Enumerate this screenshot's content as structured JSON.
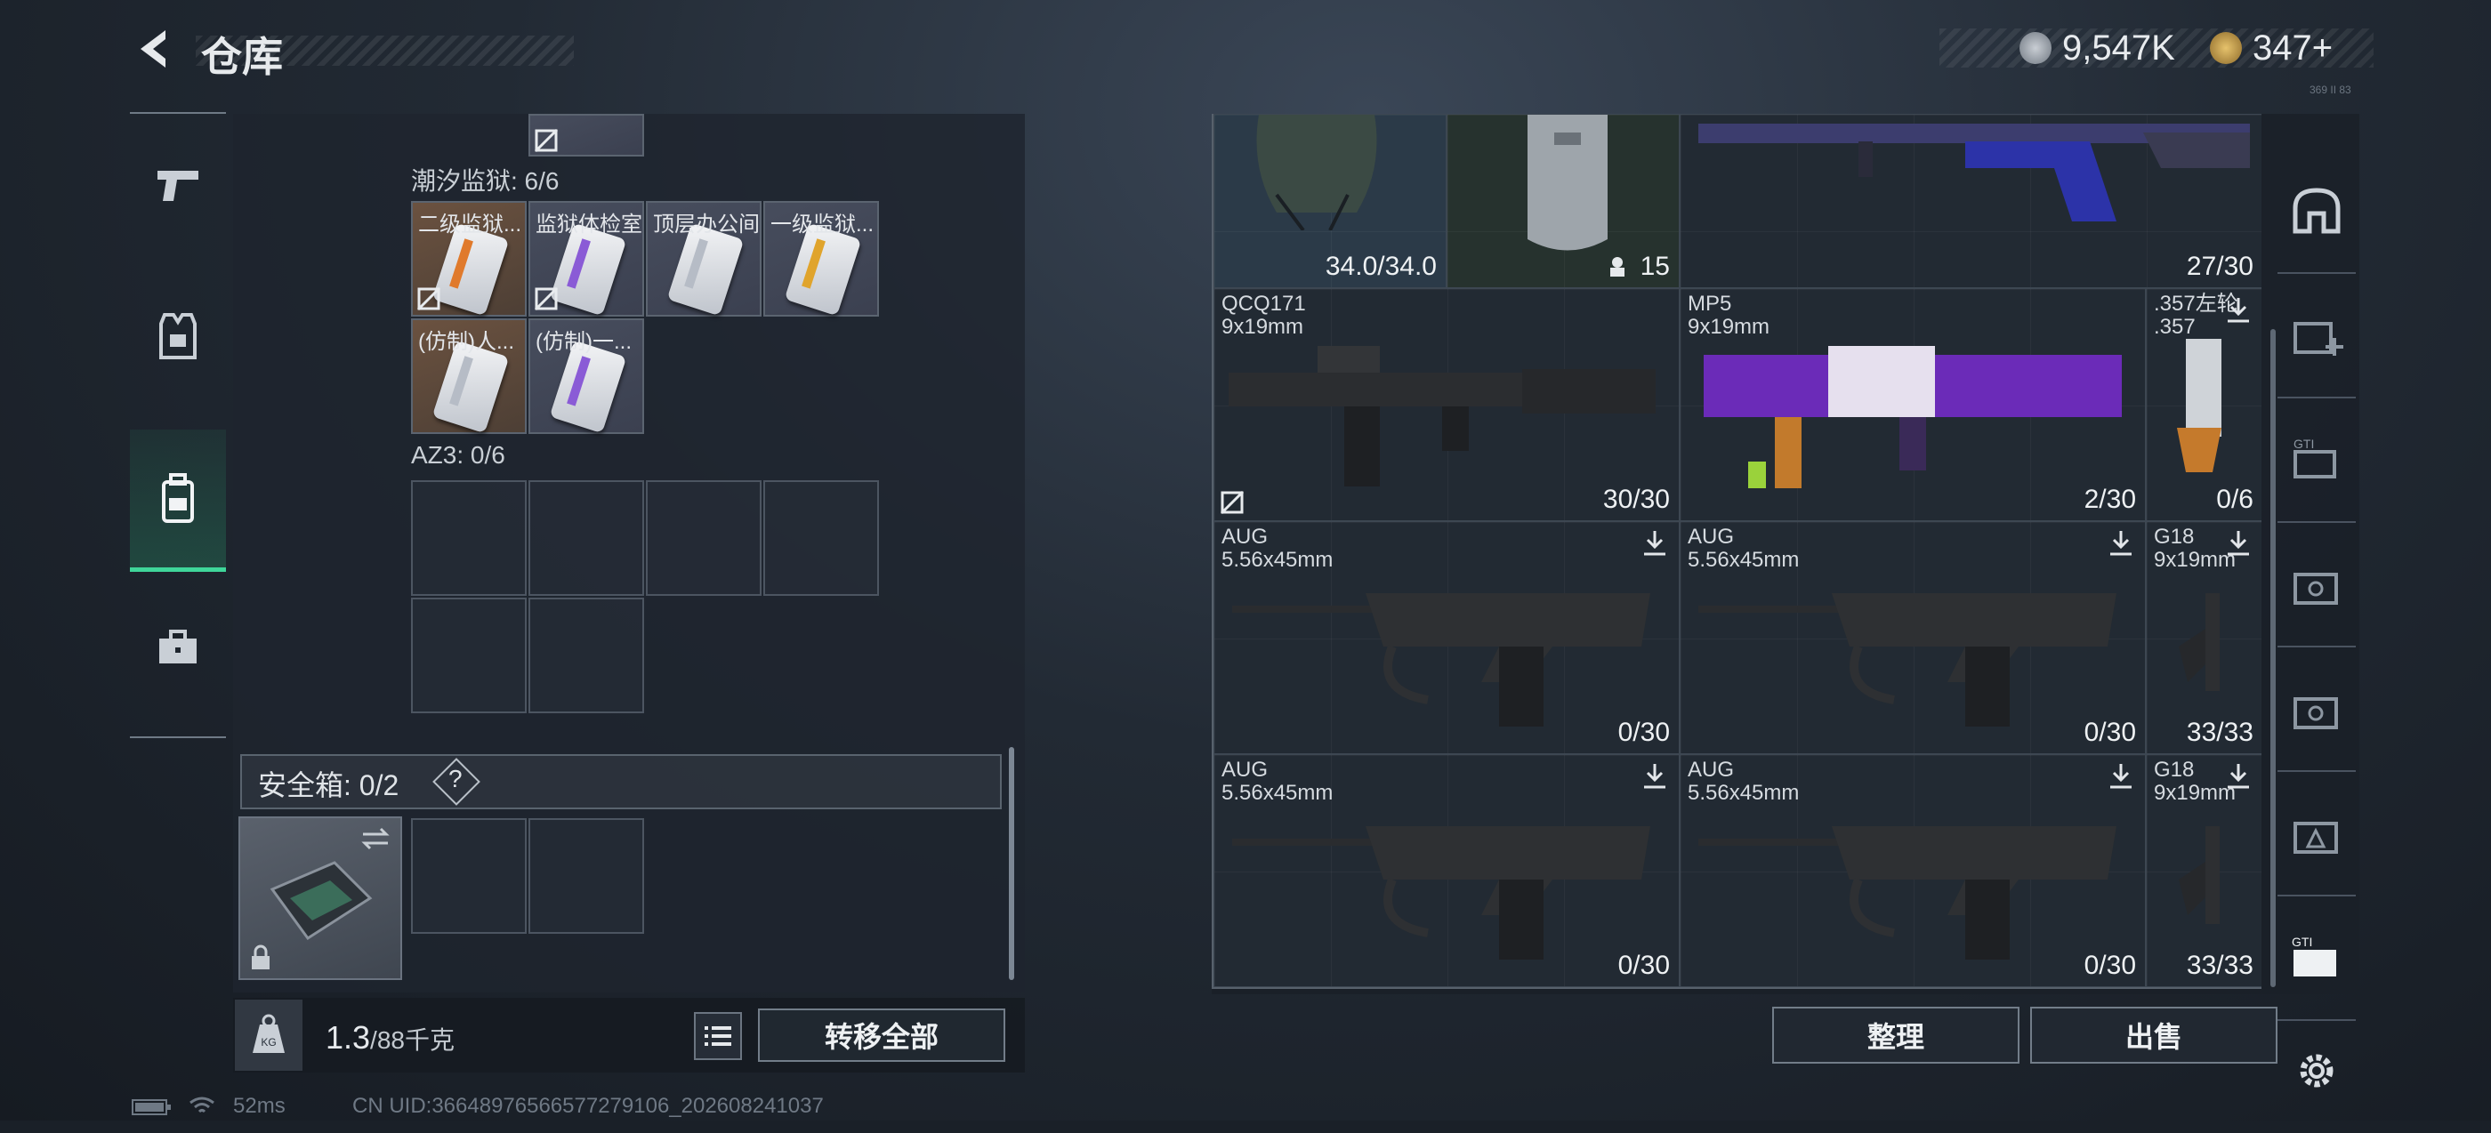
{
  "header": {
    "title": "仓库",
    "currency_1": "9,547K",
    "currency_2": "347+",
    "tiny_code": "369 II 83"
  },
  "left_nav": [
    "pistol-icon",
    "vest-icon",
    "backpack-icon",
    "toolbox-icon"
  ],
  "stash": {
    "section_a_label": "潮汐监狱: 6/6",
    "section_a_items": [
      {
        "name": "二级监狱...",
        "card": "orange-stripe",
        "no_loss": true
      },
      {
        "name": "监狱体检室",
        "card": "purple-stripe",
        "no_loss": true
      },
      {
        "name": "顶层办公间",
        "card": "plain",
        "no_loss": false
      },
      {
        "name": "一级监狱...",
        "card": "orange-stripe",
        "no_loss": false
      },
      {
        "name": "(仿制)人...",
        "card": "plain",
        "no_loss": false
      },
      {
        "name": "(仿制)一...",
        "card": "purple-stripe",
        "no_loss": false
      }
    ],
    "section_b_label": "AZ3: 0/6"
  },
  "safe_box": {
    "label": "安全箱: 0/2",
    "help": "?"
  },
  "bottom": {
    "weight_value": "1.3",
    "weight_max": "/88千克",
    "transfer_all": "转移全部",
    "organize": "整理",
    "sell": "出售"
  },
  "status": {
    "ping": "52ms",
    "uid": "CN UID:3664897656657727910​6_202608241037"
  },
  "weapons": {
    "top_left_value": "34.0/34.0",
    "top_mid_value": "15",
    "top_right_ammo": "27/30",
    "row1": [
      {
        "name": "QCQ171",
        "caliber": "9x19mm",
        "ammo": "30/30"
      },
      {
        "name": "MP5",
        "caliber": "9x19mm",
        "ammo": "2/30"
      },
      {
        "name": ".357左轮",
        "caliber": ".357",
        "ammo": "0/6"
      }
    ],
    "row2": [
      {
        "name": "AUG",
        "caliber": "5.56x45mm",
        "ammo": "0/30"
      },
      {
        "name": "AUG",
        "caliber": "5.56x45mm",
        "ammo": "0/30"
      },
      {
        "name": "G18",
        "caliber": "9x19mm",
        "ammo": "33/33"
      }
    ],
    "row3": [
      {
        "name": "AUG",
        "caliber": "5.56x45mm",
        "ammo": "0/30"
      },
      {
        "name": "AUG",
        "caliber": "5.56x45mm",
        "ammo": "0/30"
      },
      {
        "name": "G18",
        "caliber": "9x19mm",
        "ammo": "33/33"
      }
    ]
  },
  "right_nav": [
    "helmet-slot-icon",
    "t1-add-icon",
    "gti-icon",
    "t5-icon",
    "t4-icon",
    "t3-icon",
    "gti-active-icon",
    "settings-gear-icon"
  ]
}
